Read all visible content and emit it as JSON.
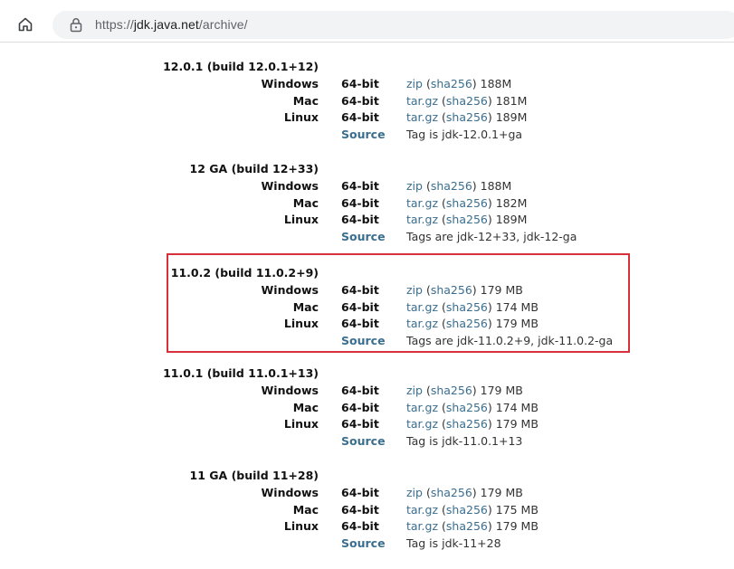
{
  "browser": {
    "url_scheme": "https://",
    "url_host": "jdk.java.net",
    "url_path": "/archive/"
  },
  "releases": [
    {
      "title": "12.0.1 (build 12.0.1+12)",
      "rows": [
        {
          "os": "Windows",
          "arch": "64-bit",
          "pkg": "zip",
          "sha": "sha256",
          "size": "188M"
        },
        {
          "os": "Mac",
          "arch": "64-bit",
          "pkg": "tar.gz",
          "sha": "sha256",
          "size": "181M"
        },
        {
          "os": "Linux",
          "arch": "64-bit",
          "pkg": "tar.gz",
          "sha": "sha256",
          "size": "189M"
        }
      ],
      "source": "Source",
      "tags": "Tag is jdk-12.0.1+ga"
    },
    {
      "title": "12 GA (build 12+33)",
      "rows": [
        {
          "os": "Windows",
          "arch": "64-bit",
          "pkg": "zip",
          "sha": "sha256",
          "size": "188M"
        },
        {
          "os": "Mac",
          "arch": "64-bit",
          "pkg": "tar.gz",
          "sha": "sha256",
          "size": "182M"
        },
        {
          "os": "Linux",
          "arch": "64-bit",
          "pkg": "tar.gz",
          "sha": "sha256",
          "size": "189M"
        }
      ],
      "source": "Source",
      "tags": "Tags are jdk-12+33, jdk-12-ga"
    },
    {
      "title": "11.0.2 (build 11.0.2+9)",
      "rows": [
        {
          "os": "Windows",
          "arch": "64-bit",
          "pkg": "zip",
          "sha": "sha256",
          "size": "179 MB"
        },
        {
          "os": "Mac",
          "arch": "64-bit",
          "pkg": "tar.gz",
          "sha": "sha256",
          "size": "174 MB"
        },
        {
          "os": "Linux",
          "arch": "64-bit",
          "pkg": "tar.gz",
          "sha": "sha256",
          "size": "179 MB"
        }
      ],
      "source": "Source",
      "tags": "Tags are jdk-11.0.2+9, jdk-11.0.2-ga"
    },
    {
      "title": "11.0.1 (build 11.0.1+13)",
      "rows": [
        {
          "os": "Windows",
          "arch": "64-bit",
          "pkg": "zip",
          "sha": "sha256",
          "size": "179 MB"
        },
        {
          "os": "Mac",
          "arch": "64-bit",
          "pkg": "tar.gz",
          "sha": "sha256",
          "size": "174 MB"
        },
        {
          "os": "Linux",
          "arch": "64-bit",
          "pkg": "tar.gz",
          "sha": "sha256",
          "size": "179 MB"
        }
      ],
      "source": "Source",
      "tags": "Tag is jdk-11.0.1+13"
    },
    {
      "title": "11 GA (build 11+28)",
      "rows": [
        {
          "os": "Windows",
          "arch": "64-bit",
          "pkg": "zip",
          "sha": "sha256",
          "size": "179 MB"
        },
        {
          "os": "Mac",
          "arch": "64-bit",
          "pkg": "tar.gz",
          "sha": "sha256",
          "size": "175 MB"
        },
        {
          "os": "Linux",
          "arch": "64-bit",
          "pkg": "tar.gz",
          "sha": "sha256",
          "size": "179 MB"
        }
      ],
      "source": "Source",
      "tags": "Tag is jdk-11+28"
    }
  ],
  "highlight": {
    "release_index": 2,
    "color": "#d6313a"
  },
  "colors": {
    "link": "#3a6e8f",
    "text": "#333333"
  }
}
